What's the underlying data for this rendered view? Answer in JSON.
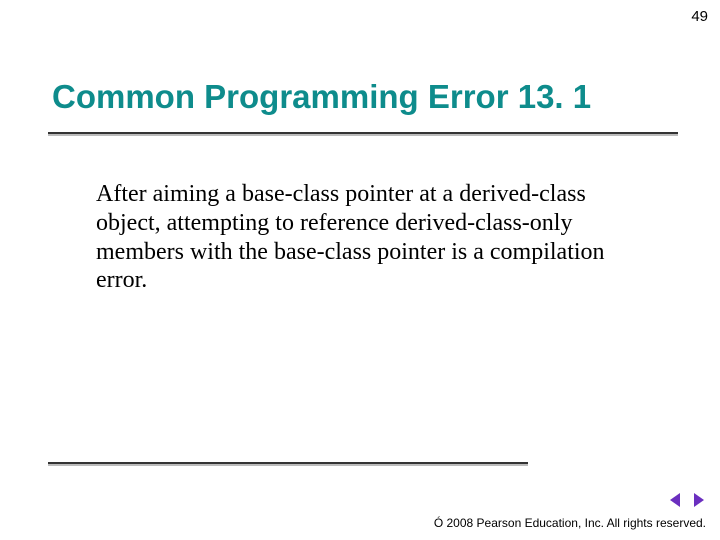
{
  "page_number": "49",
  "title": "Common Programming Error 13. 1",
  "body": "After aiming a base-class pointer at a derived-class object, attempting to reference derived-class-only members with the base-class pointer is a compilation error.",
  "footer": "Ó 2008 Pearson Education, Inc.  All rights reserved.",
  "nav": {
    "prev": "previous-slide",
    "next": "next-slide"
  }
}
